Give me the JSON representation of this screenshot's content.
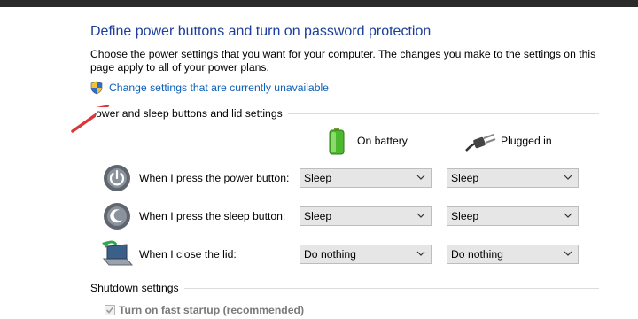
{
  "header": {
    "title": "Define power buttons and turn on password protection",
    "description": "Choose the power settings that you want for your computer. The changes you make to the settings on this page apply to all of your power plans.",
    "change_link": "Change settings that are currently unavailable"
  },
  "power_section": {
    "label": "ower and sleep buttons and lid settings",
    "columns": [
      {
        "label": "On battery",
        "icon": "battery-icon"
      },
      {
        "label": "Plugged in",
        "icon": "power-plug-icon"
      }
    ],
    "rows": [
      {
        "label": "When I press the power button:",
        "icon": "power-button-icon",
        "on_battery": "Sleep",
        "plugged_in": "Sleep"
      },
      {
        "label": "When I press the sleep button:",
        "icon": "sleep-button-icon",
        "on_battery": "Sleep",
        "plugged_in": "Sleep"
      },
      {
        "label": "When I close the lid:",
        "icon": "laptop-lid-icon",
        "on_battery": "Do nothing",
        "plugged_in": "Do nothing"
      }
    ]
  },
  "shutdown_section": {
    "label": "Shutdown settings",
    "fast_startup": {
      "label": "Turn on fast startup (recommended)",
      "checked": true,
      "enabled": false
    }
  },
  "colors": {
    "title": "#1a3e9a",
    "link": "#0b5fb8",
    "annotation_arrow": "#d9383a"
  }
}
